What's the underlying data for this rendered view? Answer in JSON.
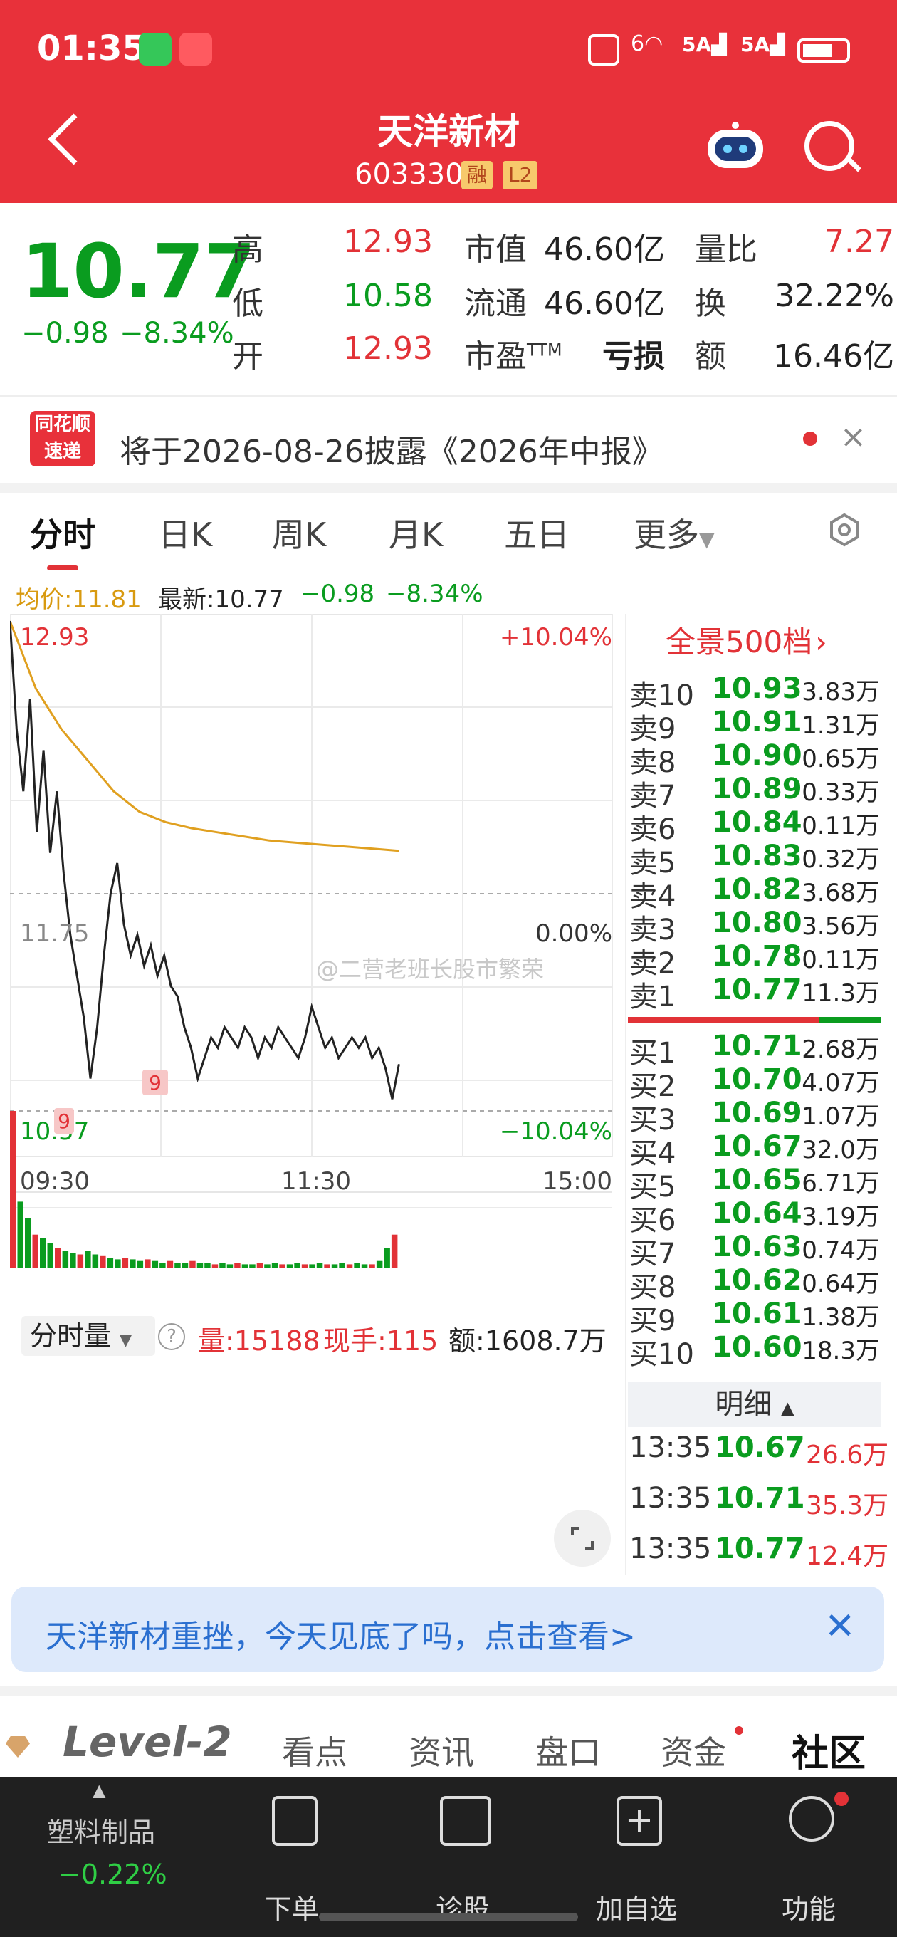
{
  "status_bar": {
    "time": "01:35",
    "right_icons": [
      "nfc-icon",
      "wifi-icon",
      "signal-5a-icon",
      "signal-5a-icon",
      "battery-icon"
    ]
  },
  "header": {
    "title": "天洋新材",
    "code": "603330",
    "tag1": "融",
    "tag2": "L2"
  },
  "quote": {
    "price": "10.77",
    "change": "−0.98",
    "change_pct": "−8.34%",
    "labels": {
      "high": "高",
      "low": "低",
      "open": "开",
      "mktcap": "市值",
      "float": "流通",
      "pe": "市盈",
      "pe_sup": "TTM",
      "vol_ratio": "量比",
      "turnover": "换",
      "amount": "额"
    },
    "high": "12.93",
    "low": "10.58",
    "open": "12.93",
    "mktcap_val": "46.60亿",
    "float_val": "46.60亿",
    "pe_val": "亏损",
    "vol_ratio_val": "7.27",
    "turnover_val": "32.22%",
    "amount_val": "16.46亿"
  },
  "notice": {
    "logo_line1": "同花顺",
    "logo_line2": "速递",
    "text": "将于2026-08-26披露《2026年中报》",
    "close": "×"
  },
  "tabs": [
    "分时",
    "日K",
    "周K",
    "月K",
    "五日",
    "更多"
  ],
  "info_line": {
    "avg": "均价:11.81",
    "latest": "最新:10.77",
    "chg": "−0.98",
    "pct": "−8.34%"
  },
  "chart_data": {
    "type": "line",
    "x_ticks": [
      "09:30",
      "11:30",
      "15:00"
    ],
    "y_left_top": "12.93",
    "y_left_mid": "11.75",
    "y_left_bottom": "10.57",
    "y_right_top": "+10.04%",
    "y_right_mid": "0.00%",
    "y_right_bottom": "−10.04%",
    "ylim": [
      10.57,
      12.93
    ],
    "markers": [
      "9",
      "9"
    ],
    "watermark": "@二营老班长股市繁荣",
    "price_series": [
      12.93,
      12.4,
      12.1,
      12.55,
      11.9,
      12.3,
      11.8,
      12.1,
      11.7,
      11.4,
      11.2,
      11.0,
      10.7,
      10.95,
      11.3,
      11.6,
      11.75,
      11.45,
      11.3,
      11.4,
      11.25,
      11.35,
      11.2,
      11.3,
      11.15,
      11.1,
      10.95,
      10.85,
      10.7,
      10.8,
      10.9,
      10.85,
      10.95,
      10.9,
      10.85,
      10.95,
      10.9,
      10.8,
      10.9,
      10.85,
      10.95,
      10.9,
      10.85,
      10.8,
      10.9,
      11.05,
      10.95,
      10.85,
      10.9,
      10.8,
      10.85,
      10.9,
      10.85,
      10.9,
      10.8,
      10.85,
      10.75,
      10.6,
      10.77
    ],
    "avg_series": [
      12.93,
      12.6,
      12.4,
      12.25,
      12.1,
      12.0,
      11.95,
      11.92,
      11.9,
      11.88,
      11.86,
      11.85,
      11.84,
      11.83,
      11.82,
      11.81
    ],
    "volume_bars": [
      95,
      40,
      30,
      20,
      18,
      15,
      12,
      10,
      9,
      8,
      10,
      8,
      7,
      6,
      5,
      6,
      5,
      4,
      5,
      4,
      3,
      4,
      3,
      3,
      4,
      3,
      3,
      2,
      3,
      2,
      3,
      2,
      2,
      3,
      2,
      3,
      2,
      2,
      3,
      2,
      2,
      3,
      2,
      2,
      3,
      2,
      3,
      2,
      2,
      4,
      12,
      20
    ]
  },
  "order_book": {
    "title": "全景500档",
    "asks": [
      {
        "label": "卖10",
        "price": "10.93",
        "vol": "3.83万"
      },
      {
        "label": "卖9",
        "price": "10.91",
        "vol": "1.31万"
      },
      {
        "label": "卖8",
        "price": "10.90",
        "vol": "0.65万"
      },
      {
        "label": "卖7",
        "price": "10.89",
        "vol": "0.33万"
      },
      {
        "label": "卖6",
        "price": "10.84",
        "vol": "0.11万"
      },
      {
        "label": "卖5",
        "price": "10.83",
        "vol": "0.32万"
      },
      {
        "label": "卖4",
        "price": "10.82",
        "vol": "3.68万"
      },
      {
        "label": "卖3",
        "price": "10.80",
        "vol": "3.56万"
      },
      {
        "label": "卖2",
        "price": "10.78",
        "vol": "0.11万"
      },
      {
        "label": "卖1",
        "price": "10.77",
        "vol": "11.3万"
      }
    ],
    "bids": [
      {
        "label": "买1",
        "price": "10.71",
        "vol": "2.68万"
      },
      {
        "label": "买2",
        "price": "10.70",
        "vol": "4.07万"
      },
      {
        "label": "买3",
        "price": "10.69",
        "vol": "1.07万"
      },
      {
        "label": "买4",
        "price": "10.67",
        "vol": "32.0万"
      },
      {
        "label": "买5",
        "price": "10.65",
        "vol": "6.71万"
      },
      {
        "label": "买6",
        "price": "10.64",
        "vol": "3.19万"
      },
      {
        "label": "买7",
        "price": "10.63",
        "vol": "0.74万"
      },
      {
        "label": "买8",
        "price": "10.62",
        "vol": "0.64万"
      },
      {
        "label": "买9",
        "price": "10.61",
        "vol": "1.38万"
      },
      {
        "label": "买10",
        "price": "10.60",
        "vol": "18.3万"
      }
    ],
    "detail_title": "明细",
    "details": [
      {
        "time": "13:35",
        "price": "10.67",
        "vol": "26.6万"
      },
      {
        "time": "13:35",
        "price": "10.71",
        "vol": "35.3万"
      },
      {
        "time": "13:35",
        "price": "10.77",
        "vol": "12.4万"
      }
    ]
  },
  "volume": {
    "dropdown": "分时量",
    "help": "?",
    "vol": "量:15188",
    "now": "现手:115",
    "amount": "额:1608.7万"
  },
  "banner": {
    "text": "天洋新材重挫，今天见底了吗，点击查看>",
    "close": "✕"
  },
  "bottom_tabs": [
    "Level-2",
    "看点",
    "资讯",
    "盘口",
    "资金",
    "社区"
  ],
  "footer": {
    "sector_name": "塑料制品",
    "sector_change": "−0.22%",
    "items": [
      "下单",
      "诊股",
      "加自选",
      "功能"
    ]
  },
  "colors": {
    "red": "#e23237",
    "green": "#0a9c1f",
    "header_red": "#e8313a",
    "avg_line": "#e0a020"
  }
}
